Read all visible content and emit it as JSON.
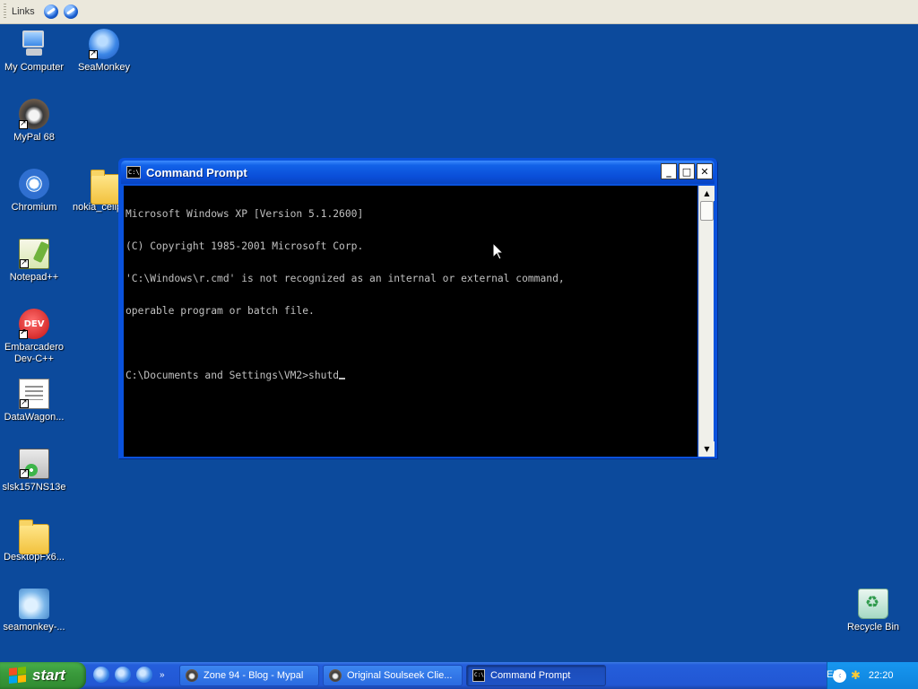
{
  "links_bar": {
    "label": "Links"
  },
  "desktop": {
    "icons": [
      {
        "label": "My Computer"
      },
      {
        "label": "SeaMonkey"
      },
      {
        "label": "MyPal 68"
      },
      {
        "label": "Chromium"
      },
      {
        "label": "nokia_cellp"
      },
      {
        "label": "Notepad++"
      },
      {
        "label": "Embarcadero\nDev-C++"
      },
      {
        "label": "DataWagon..."
      },
      {
        "label": "slsk157NS13e"
      },
      {
        "label": "DesktopFx6..."
      },
      {
        "label": "seamonkey-..."
      },
      {
        "label": "Recycle Bin"
      }
    ]
  },
  "window": {
    "title": "Command Prompt",
    "icon_text": "C:\\",
    "buttons": {
      "minimize": "_",
      "maximize": "□",
      "close": "✕"
    },
    "console_lines": [
      "Microsoft Windows XP [Version 5.1.2600]",
      "(C) Copyright 1985-2001 Microsoft Corp.",
      "'C:\\Windows\\r.cmd' is not recognized as an internal or external command,",
      "operable program or batch file.",
      "",
      "C:\\Documents and Settings\\VM2>shutd"
    ]
  },
  "taskbar": {
    "start_label": "start",
    "quick_launch_more": "»",
    "tasks": [
      {
        "label": "Zone 94 - Blog - Mypal"
      },
      {
        "label": "Original Soulseek Clie..."
      },
      {
        "label": "Command Prompt"
      }
    ],
    "language": "EN",
    "clock": "22:20"
  },
  "colors": {
    "desktop": "#0c4a9c",
    "titlebar": "#0a52dc",
    "start": "#3a9a3c"
  }
}
